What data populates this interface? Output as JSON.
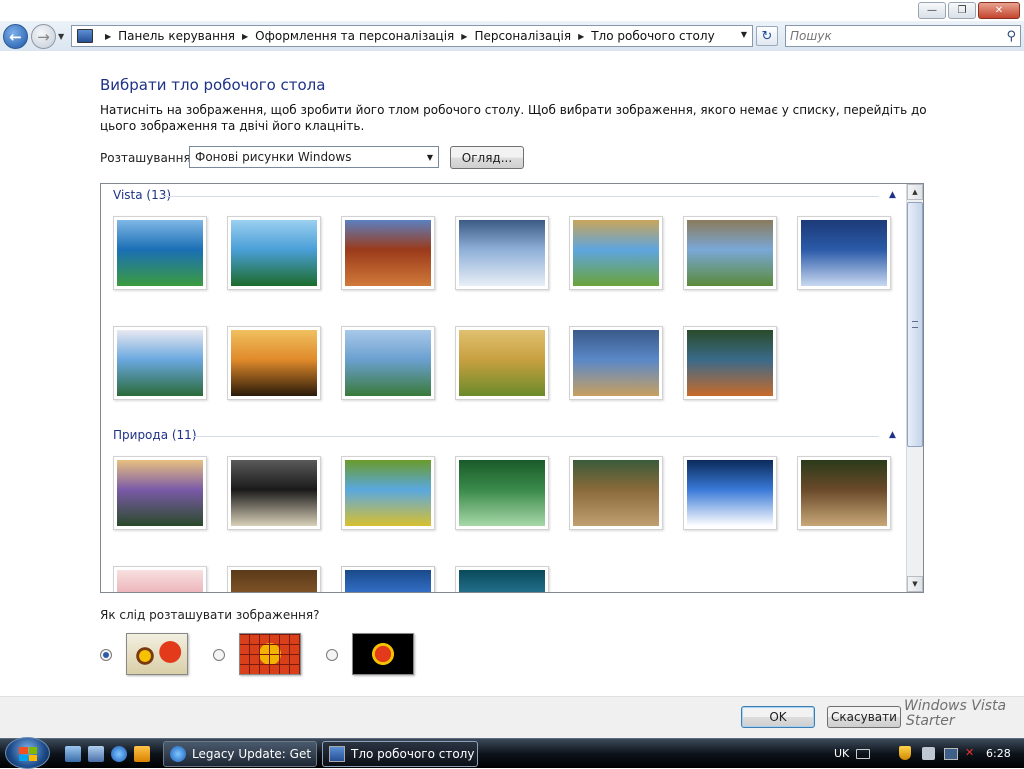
{
  "window": {
    "controls": {
      "minimize": "—",
      "maximize": "❐",
      "close": "✕"
    }
  },
  "nav": {
    "back_glyph": "←",
    "forward_glyph": "→",
    "breadcrumb": [
      "Панель керування",
      "Оформлення та персоналізація",
      "Персоналізація",
      "Тло робочого столу"
    ],
    "search_placeholder": "Пошук"
  },
  "page": {
    "title": "Вибрати тло робочого стола",
    "description": "Натисніть на зображення, щоб зробити його тлом робочого столу. Щоб вибрати зображення, якого немає у списку, перейдіть до цього зображення та двічі його клацніть.",
    "location_label": "Розташування",
    "location_value": "Фонові рисунки Windows",
    "browse_label": "Огляд...",
    "groups": [
      {
        "title": "Vista (13)",
        "count": 13,
        "colors": [
          [
            "#1a6fb5",
            "#3b9b3e",
            "#7fb7e6"
          ],
          [
            "#4a9fd8",
            "#1c6b2a",
            "#9bd0f0"
          ],
          [
            "#9b3a1a",
            "#d07a3a",
            "#5b7fc0"
          ],
          [
            "#8fb0d8",
            "#e8eef6",
            "#3b5a84"
          ],
          [
            "#5ea5e0",
            "#6ba33a",
            "#c9a55a"
          ],
          [
            "#7aa8d8",
            "#5a8a3a",
            "#8a7a5a"
          ],
          [
            "#2a5aa8",
            "#c8d8f0",
            "#1c3a78"
          ],
          [
            "#6aa8e0",
            "#2a6a3a",
            "#e8e8f0"
          ],
          [
            "#e08a2a",
            "#2a1a0a",
            "#f0c060"
          ],
          [
            "#6aa0d0",
            "#3a7a3a",
            "#a8c8e8"
          ],
          [
            "#c8a040",
            "#6a8a2a",
            "#e0c070"
          ],
          [
            "#5a88c8",
            "#c8a060",
            "#3a5a8a"
          ],
          [
            "#3a6a8a",
            "#c86a2a",
            "#2a4a2a"
          ]
        ]
      },
      {
        "title": "Природа (11)",
        "count": 11,
        "colors": [
          [
            "#7a5aa8",
            "#2a4a2a",
            "#e8c080"
          ],
          [
            "#1a1a1a",
            "#d8d0b8",
            "#5a5a5a"
          ],
          [
            "#5aa8e0",
            "#d8c030",
            "#6a9a2a"
          ],
          [
            "#3a8a4a",
            "#a8d8a8",
            "#1a5a2a"
          ],
          [
            "#8a6a3a",
            "#c0a070",
            "#3a5a3a"
          ],
          [
            "#3a7ad8",
            "#ffffff",
            "#0a2a5a"
          ],
          [
            "#6a4a2a",
            "#c8a878",
            "#2a3a1a"
          ],
          [
            "#e8a8b0",
            "#d85a6a",
            "#f8e0e0"
          ],
          [
            "#8a5a2a",
            "#d8b078",
            "#5a3a1a"
          ],
          [
            "#3a7ad8",
            "#f0c020",
            "#1a4a8a"
          ],
          [
            "#2a7a9a",
            "#9ad8e0",
            "#0a4a5a"
          ]
        ]
      }
    ],
    "position_label": "Як слід розташувати зображення?",
    "position_options": [
      "Розтягнути",
      "Мозаїка",
      "По центру"
    ],
    "position_selected": 0
  },
  "footer": {
    "ok_label": "OK",
    "cancel_label": "Скасувати",
    "watermark_1": "Windows Vista",
    "watermark_2": "Starter"
  },
  "taskbar": {
    "tasks": [
      {
        "label": "Legacy Update: Get ...",
        "active": false
      },
      {
        "label": "Тло робочого столу",
        "active": true
      }
    ],
    "language": "UK",
    "time": "6:28"
  }
}
